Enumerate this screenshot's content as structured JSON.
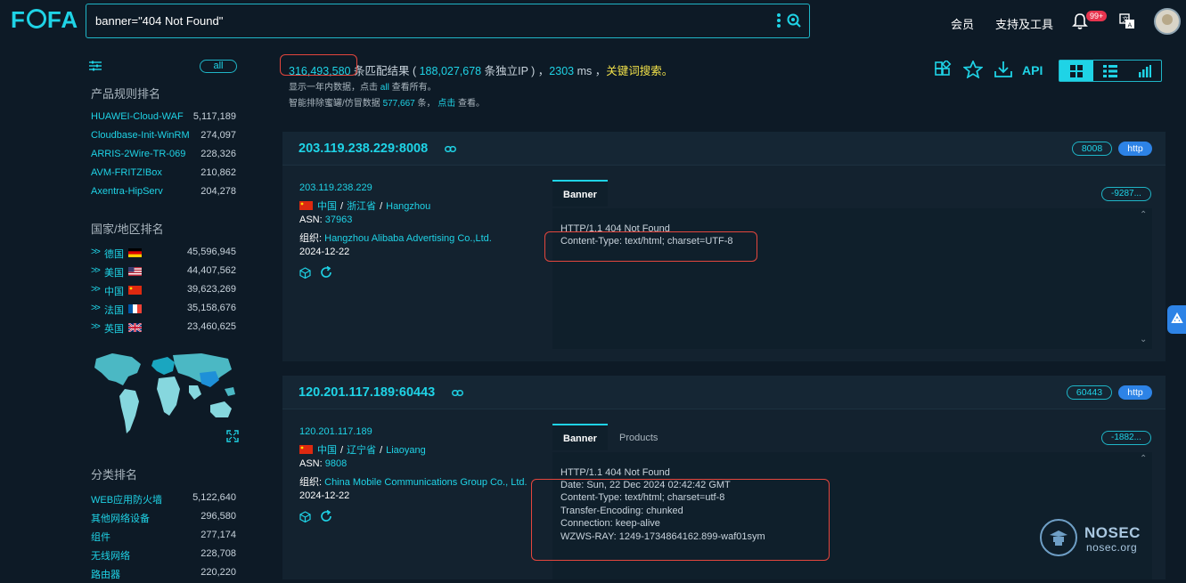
{
  "brand": {
    "logo_text": "FOFA"
  },
  "search": {
    "query": "banner=\"404 Not Found\""
  },
  "nav": {
    "member": "会员",
    "support": "支持及工具",
    "notifications_badge": "99+"
  },
  "sidebar": {
    "filter_all": "all",
    "product_title": "产品规则排名",
    "products": [
      {
        "name": "HUAWEI-Cloud-WAF",
        "count": "5,117,189"
      },
      {
        "name": "Cloudbase-Init-WinRM",
        "count": "274,097"
      },
      {
        "name": "ARRIS-2Wire-TR-069",
        "count": "228,326"
      },
      {
        "name": "AVM-FRITZ!Box",
        "count": "210,862"
      },
      {
        "name": "Axentra-HipServ",
        "count": "204,278"
      }
    ],
    "country_title": "国家/地区排名",
    "countries": [
      {
        "name": "德国",
        "count": "45,596,945",
        "flag": "de"
      },
      {
        "name": "美国",
        "count": "44,407,562",
        "flag": "us"
      },
      {
        "name": "中国",
        "count": "39,623,269",
        "flag": "cn"
      },
      {
        "name": "法国",
        "count": "35,158,676",
        "flag": "fr"
      },
      {
        "name": "英国",
        "count": "23,460,625",
        "flag": "gb"
      }
    ],
    "category_title": "分类排名",
    "categories": [
      {
        "name": "WEB应用防火墙",
        "count": "5,122,640"
      },
      {
        "name": "其他网络设备",
        "count": "296,580"
      },
      {
        "name": "组件",
        "count": "277,174"
      },
      {
        "name": "无线网络",
        "count": "228,708"
      },
      {
        "name": "路由器",
        "count": "220,220"
      }
    ]
  },
  "summary": {
    "total": "316,493,580",
    "text1": " 条匹配结果 ( ",
    "unique_ips": "188,027,678",
    "text2": " 条独立IP ) ，",
    "time": "2303",
    "text3": " ms ，",
    "keyword": "关键词搜索。",
    "hint1_a": "显示一年内数据，点击 ",
    "hint1_link": "all",
    "hint1_b": " 查看所有。",
    "hint2_a": "智能排除蜜罐/仿冒数据 ",
    "hint2_count": "577,667",
    "hint2_b": " 条， ",
    "hint2_link": "点击",
    "hint2_c": " 查看。"
  },
  "toolbar": {
    "api_label": "API"
  },
  "results": [
    {
      "host": "203.119.238.229:8008",
      "port": "8008",
      "protocol": "http",
      "ip": "203.119.238.229",
      "country": "中国",
      "province": "浙江省",
      "city": "Hangzhou",
      "asn_label": "ASN:",
      "asn": "37963",
      "org_label": "组织:",
      "org": "Hangzhou Alibaba Advertising Co.,Ltd.",
      "date": "2024-12-22",
      "tab_banner": "Banner",
      "count_pill": "-9287...",
      "banner_lines": [
        "HTTP/1.1 404 Not Found",
        "Content-Type: text/html; charset=UTF-8"
      ]
    },
    {
      "host": "120.201.117.189:60443",
      "port": "60443",
      "protocol": "http",
      "ip": "120.201.117.189",
      "country": "中国",
      "province": "辽宁省",
      "city": "Liaoyang",
      "asn_label": "ASN:",
      "asn": "9808",
      "org_label": "组织:",
      "org": "China Mobile Communications Group Co., Ltd.",
      "date": "2024-12-22",
      "tab_banner": "Banner",
      "tab_products": "Products",
      "count_pill": "-1882...",
      "banner_lines": [
        "HTTP/1.1 404 Not Found",
        "Date: Sun, 22 Dec 2024 02:42:42 GMT",
        "Content-Type: text/html; charset=utf-8",
        "Transfer-Encoding: chunked",
        "Connection: keep-alive",
        "WZWS-RAY: 1249-1734864162.899-waf01sym"
      ]
    }
  ],
  "watermark": {
    "title": "NOSEC",
    "domain": "nosec.org"
  },
  "colors": {
    "accent": "#1fd3e6",
    "background": "#0d1a26",
    "card": "#13222f",
    "highlight_box": "#e4463d",
    "keyword": "#f2e24a"
  }
}
